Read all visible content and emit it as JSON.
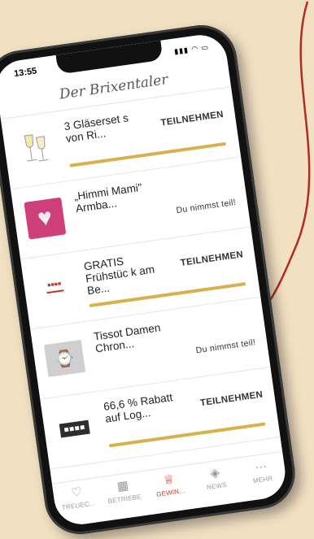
{
  "status": {
    "time": "13:55",
    "indicators": "signal wifi battery"
  },
  "header": {
    "logo_text": "Der Brixentaler"
  },
  "items": [
    {
      "title": "3 Gläserset s von Ri...",
      "action": "TEILNEHMEN",
      "state": "open",
      "thumb": "wine-glasses"
    },
    {
      "title": "„Himmi Mami\" Armba...",
      "action": "Du nimmst teil!",
      "state": "joined",
      "thumb": "heart-bracelet"
    },
    {
      "title": "GRATIS Frühstüc k am Be...",
      "action": "TEILNEHMEN",
      "state": "open",
      "thumb": "kitzbueheler-logo"
    },
    {
      "title": "Tissot Damen Chron...",
      "action": "Du nimmst teil!",
      "state": "joined",
      "thumb": "watch"
    },
    {
      "title": "66,6 % Rabatt auf Log...",
      "action": "TEILNEHMEN",
      "state": "open",
      "thumb": "ginne-logo"
    }
  ],
  "tabs": [
    {
      "label": "TREUEC...",
      "icon": "heart-hand-icon",
      "glyph": "♡"
    },
    {
      "label": "BETRIEBE",
      "icon": "store-icon",
      "glyph": "▦"
    },
    {
      "label": "GEWIN...",
      "icon": "trophy-icon",
      "glyph": "♕",
      "active": true
    },
    {
      "label": "NEWS",
      "icon": "news-icon",
      "glyph": "◈"
    },
    {
      "label": "MEHR",
      "icon": "more-icon",
      "glyph": "···"
    }
  ],
  "colors": {
    "accent": "#c0392b",
    "progress": "#d8b14d",
    "background": "#f2e0c3"
  }
}
